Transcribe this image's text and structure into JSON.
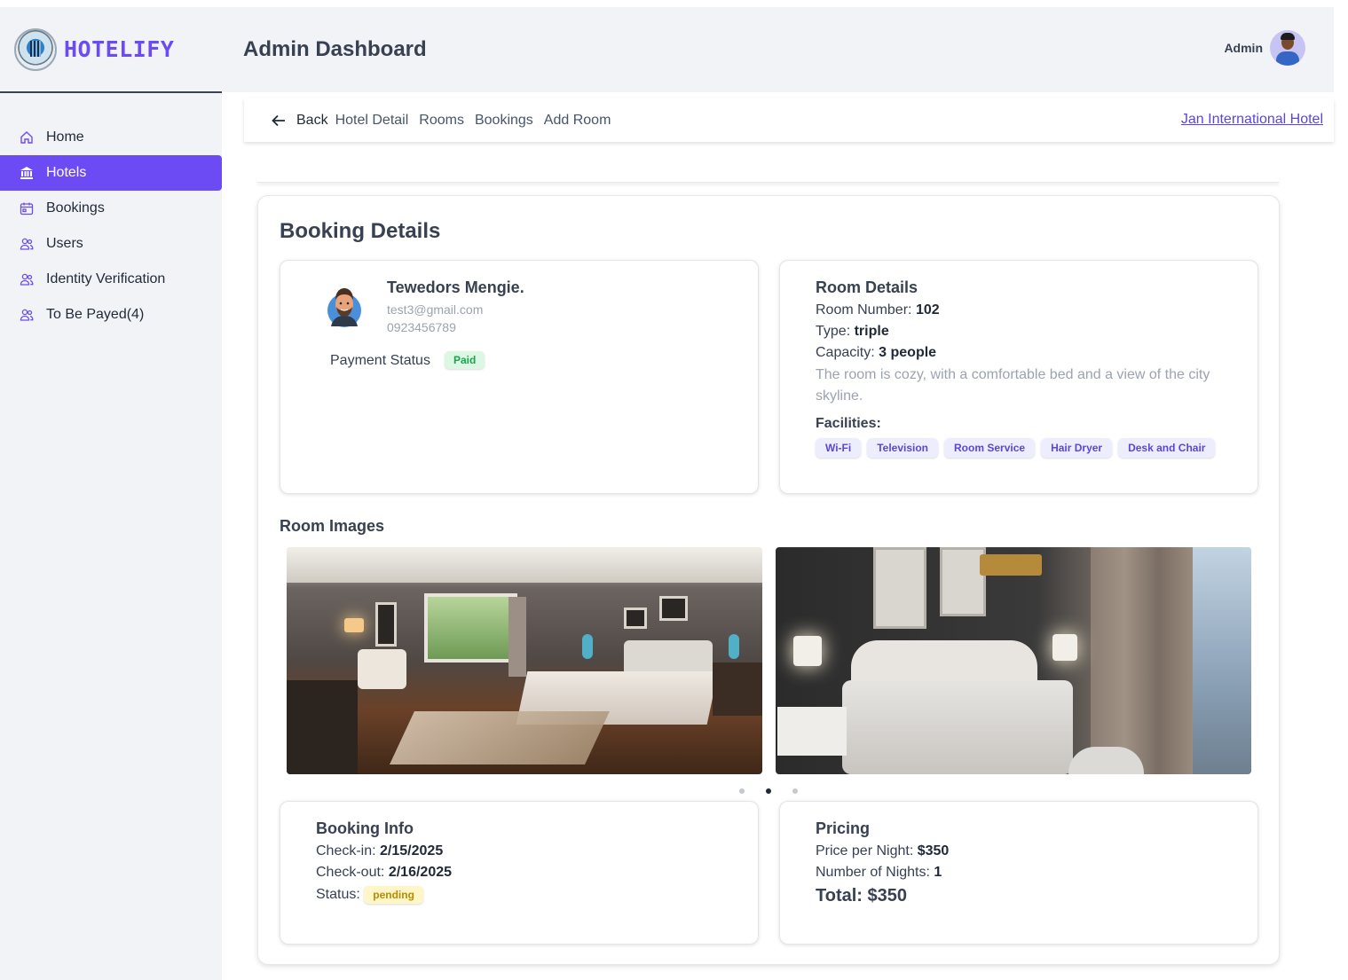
{
  "brand": {
    "name": "HOTELIFY"
  },
  "sidebar": {
    "items": [
      {
        "label": "Home",
        "icon": "home-icon"
      },
      {
        "label": "Hotels",
        "icon": "bank-icon",
        "active": true
      },
      {
        "label": "Bookings",
        "icon": "calendar-icon"
      },
      {
        "label": "Users",
        "icon": "users-icon"
      },
      {
        "label": "Identity Verification",
        "icon": "users-icon"
      },
      {
        "label": "To Be Payed(4)",
        "icon": "users-icon"
      }
    ]
  },
  "header": {
    "title": "Admin Dashboard",
    "user_label": "Admin"
  },
  "subnav": {
    "back": "Back",
    "links": [
      "Hotel Detail",
      "Rooms",
      "Bookings",
      "Add Room"
    ],
    "hotel_name": "Jan International Hotel"
  },
  "booking": {
    "title": "Booking Details",
    "guest": {
      "name": "Tewedors Mengie.",
      "email": "test3@gmail.com",
      "phone": "0923456789",
      "payment_status_label": "Payment Status",
      "payment_status": "Paid"
    },
    "room": {
      "heading": "Room Details",
      "number_label": "Room Number:",
      "number": "102",
      "type_label": "Type:",
      "type": "triple",
      "capacity_label": "Capacity:",
      "capacity": "3 people",
      "description": "The room is cozy, with a comfortable bed and a view of the city skyline.",
      "facilities_label": "Facilities:",
      "facilities": [
        "Wi-Fi",
        "Television",
        "Room Service",
        "Hair Dryer",
        "Desk and Chair"
      ]
    },
    "images_title": "Room Images",
    "carousel": {
      "dot_count": 3,
      "active_index": 1
    },
    "info": {
      "heading": "Booking Info",
      "checkin_label": "Check-in:",
      "checkin": "2/15/2025",
      "checkout_label": "Check-out:",
      "checkout": "2/16/2025",
      "status_label": "Status:",
      "status": "pending"
    },
    "pricing": {
      "heading": "Pricing",
      "price_label": "Price per Night:",
      "price": "$350",
      "nights_label": "Number of Nights:",
      "nights": "1",
      "total": "Total: $350"
    }
  },
  "colors": {
    "accent": "#6d4bf4",
    "paid": "#1ca34d",
    "pending": "#b88a06"
  }
}
